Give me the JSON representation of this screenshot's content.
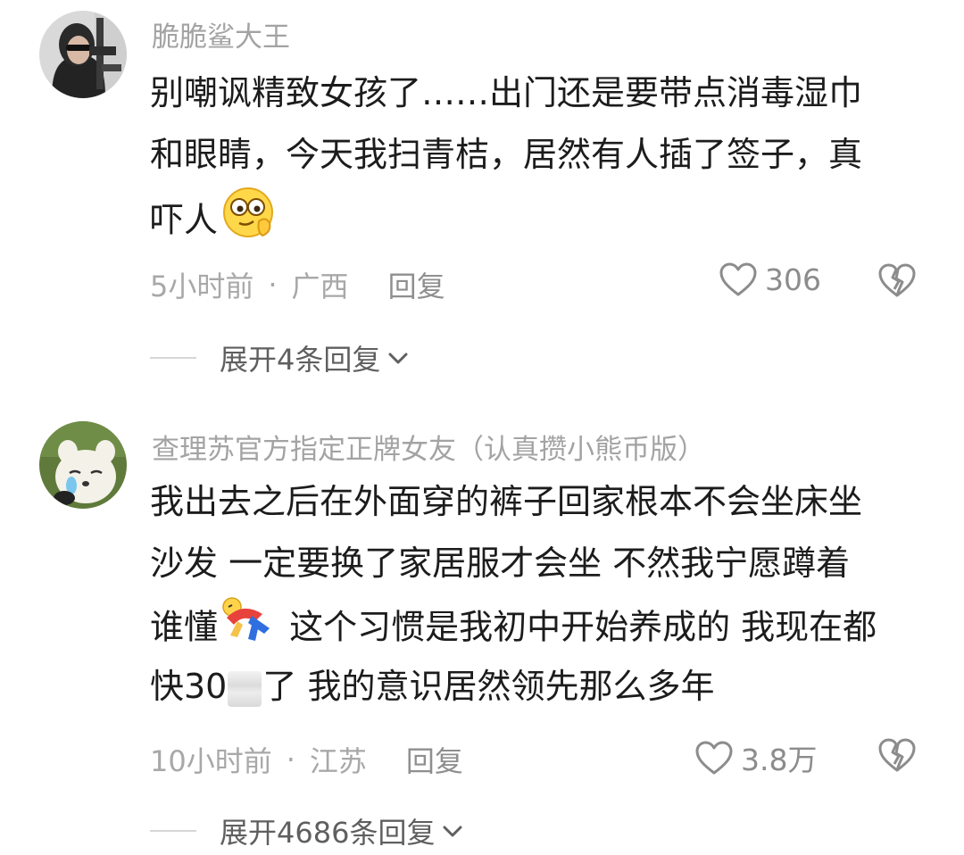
{
  "comments": [
    {
      "username": "脆脆鲨大王",
      "text_lines": [
        "别嘲讽精致女孩了……出门还是要带点消毒湿巾",
        "和眼睛，今天我扫青桔，居然有人插了签子，真",
        "吓人"
      ],
      "emoji": "thinking-face-icon",
      "time": "5小时前",
      "separator": "·",
      "location": "广西",
      "reply_label": "回复",
      "likes": "306",
      "expand_label": "展开4条回复"
    },
    {
      "username": "查理苏官方指定正牌女友（认真攒小熊币版）",
      "text_lines": [
        "我出去之后在外面穿的裤子回家根本不会坐床坐",
        "沙发 一定要换了家居服才会坐 不然我宁愿蹲着",
        "谁懂",
        " 这个习惯是我初中开始养成的 我现在都",
        "快30",
        "了 我的意识居然领先那么多年"
      ],
      "emoji": "falling-person-icon",
      "time": "10小时前",
      "separator": "·",
      "location": "江苏",
      "reply_label": "回复",
      "likes": "3.8万",
      "expand_label": "展开4686条回复"
    }
  ],
  "colors": {
    "username": "#a3a3a3",
    "text": "#1c1c1c",
    "meta": "#a8a8a8",
    "expand": "#5f5f5f"
  }
}
